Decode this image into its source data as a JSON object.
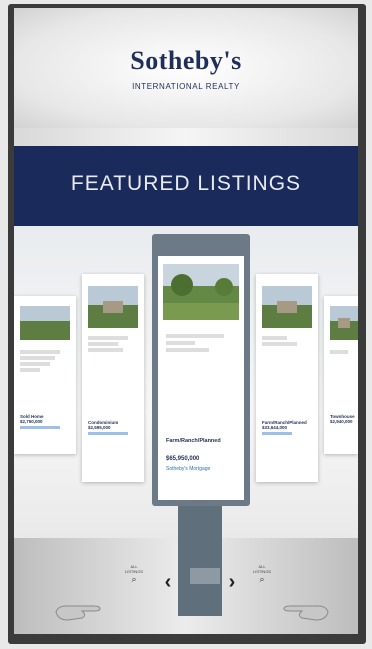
{
  "header": {
    "brand_name": "Sotheby's",
    "brand_sub": "INTERNATIONAL REALTY"
  },
  "banner": {
    "title": "FEATURED LISTINGS"
  },
  "listings": [
    {
      "position": "far-left",
      "status": "Sold Home",
      "price": "$2,750,000"
    },
    {
      "position": "left",
      "status": "Condominium",
      "price": "$2,595,000"
    },
    {
      "position": "center",
      "status": "Farm/Ranch/Planned",
      "price": "$65,950,000",
      "agent": "Sotheby's Mortgage"
    },
    {
      "position": "right",
      "status": "Farm/Ranch/Planned",
      "price": "$33,644,000"
    },
    {
      "position": "far-right",
      "status": "Townhouse",
      "price": "$2,940,000"
    }
  ],
  "controls": {
    "prev_arrow": "‹",
    "next_arrow": "›",
    "zoom_left_label": "ALL LISTINGS",
    "zoom_right_label": "ALL LISTINGS"
  },
  "colors": {
    "navy": "#1a2a5a",
    "brand_text": "#1f2f5c",
    "link": "#2a6fc5"
  },
  "icons": [
    "magnifier-icon",
    "chevron-left-icon",
    "chevron-right-icon",
    "pointing-hand-icon"
  ]
}
